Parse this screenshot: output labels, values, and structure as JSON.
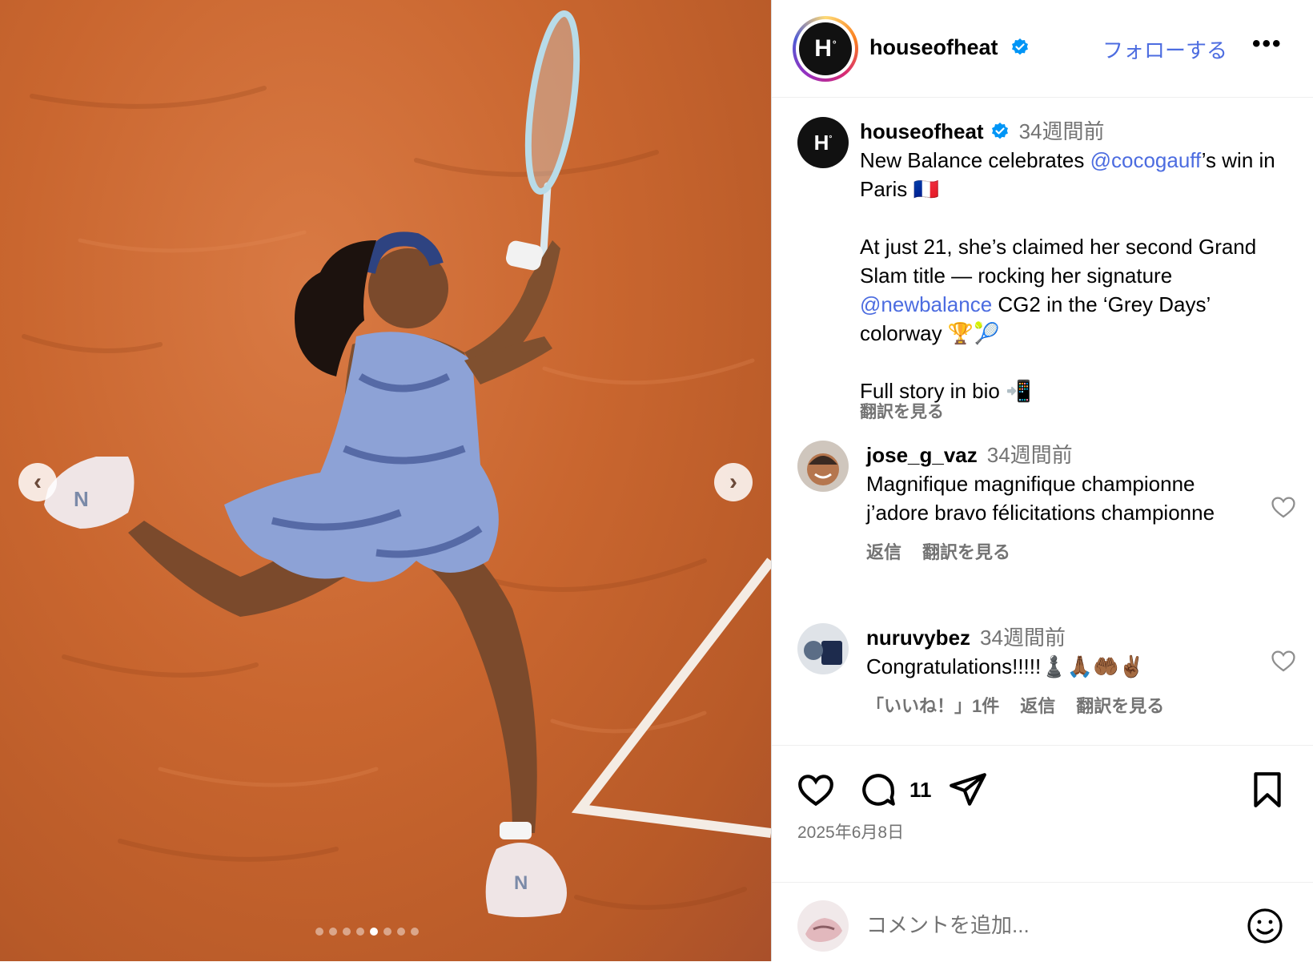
{
  "header": {
    "username": "houseofheat",
    "avatar_text": "H",
    "avatar_mark": "°",
    "follow_label": "フォローする",
    "more_label": "•••"
  },
  "caption": {
    "username": "houseofheat",
    "time": "34週間前",
    "line1_pre": "New Balance celebrates ",
    "line1_mention": "@cocogauff",
    "line1_post": "’s win in Paris 🇫🇷",
    "para2_pre": "At just 21, she’s claimed her second Grand Slam title — rocking her signature ",
    "para2_mention": "@newbalance",
    "para2_post": " CG2 in the ‘Grey Days’ colorway 🏆🎾",
    "para3": "Full story in bio 📲",
    "see_translation": "翻訳を見る"
  },
  "comments": [
    {
      "username": "jose_g_vaz",
      "time": "34週間前",
      "text": "Magnifique magnifique championne j’adore bravo félicitations championne",
      "reply": "返信",
      "translate": "翻訳を見る"
    },
    {
      "username": "nuruvybez",
      "time": "34週間前",
      "text": "Congratulations!!!!!♟️🙏🏾🤲🏾✌🏾",
      "likes": "「いいね！」1件",
      "reply": "返信",
      "translate": "翻訳を見る"
    }
  ],
  "actions": {
    "comment_count": "11",
    "date": "2025年6月8日",
    "add_comment_placeholder": "コメントを追加..."
  },
  "carousel": {
    "prev_label": "‹",
    "next_label": "›",
    "total": 8,
    "active": 4
  },
  "colors": {
    "link": "#4c6ce0",
    "muted": "#737373",
    "verified": "#0095f6",
    "clay": "#c9662f"
  },
  "icons": [
    "heart-icon",
    "comment-icon",
    "share-icon",
    "bookmark-icon",
    "emoji-icon",
    "verified-icon",
    "chevron-left-icon",
    "chevron-right-icon"
  ]
}
